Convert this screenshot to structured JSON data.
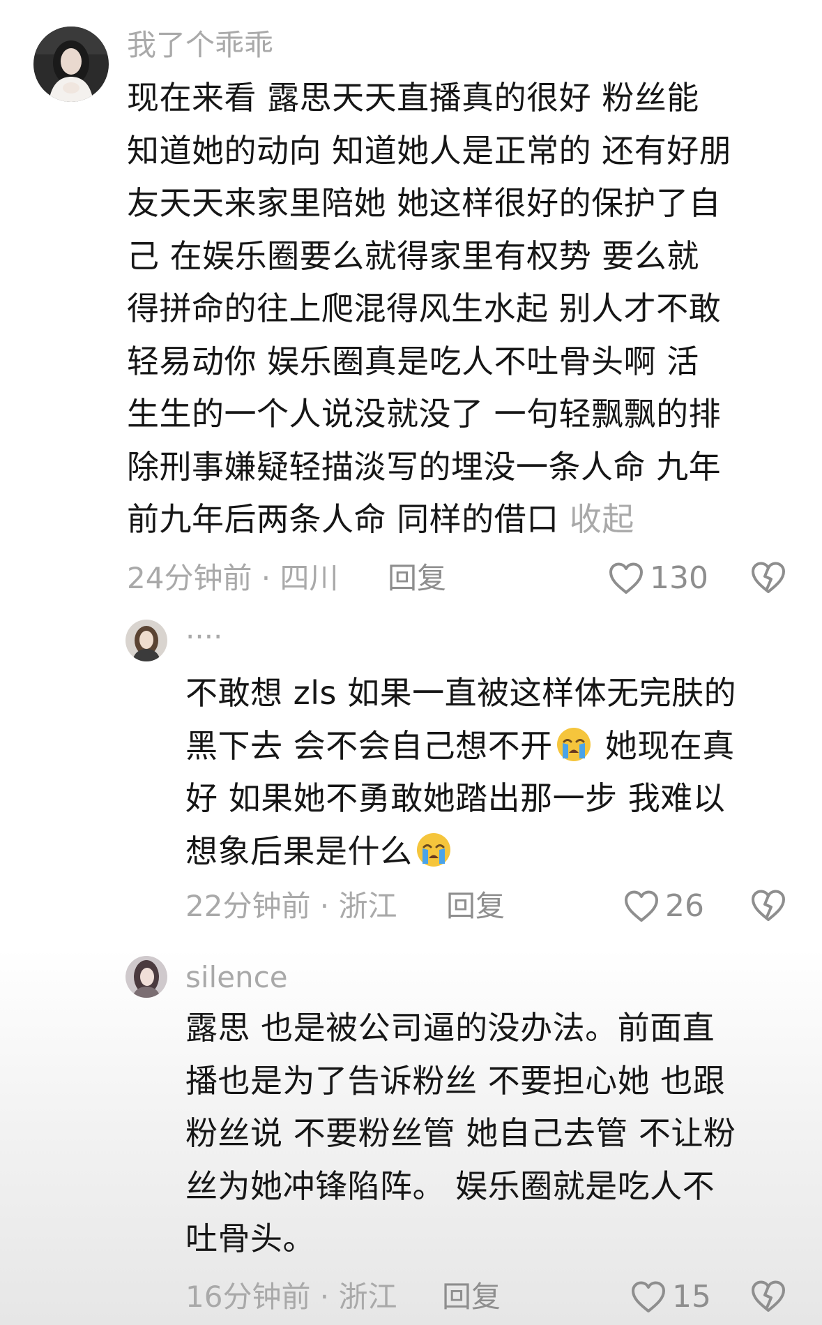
{
  "comments": [
    {
      "username": "我了个乖乖",
      "lines": [
        "现在来看  露思天天直播真的很好 粉丝能",
        "知道她的动向 知道她人是正常的 还有好朋",
        "友天天来家里陪她  她这样很好的保护了自",
        "己  在娱乐圈要么就得家里有权势  要么就",
        "得拼命的往上爬混得风生水起 别人才不敢",
        "轻易动你   娱乐圈真是吃人不吐骨头啊  活",
        "生生的一个人说没就没了  一句轻飘飘的排",
        "除刑事嫌疑轻描淡写的埋没一条人命  九年",
        "前九年后两条人命 同样的借口 "
      ],
      "collapse_label": "收起",
      "time": "24分钟前 · 四川",
      "reply_label": "回复",
      "likes": "130",
      "avatar_icon": "user-avatar",
      "like_icon": "heart-outline-icon",
      "dislike_icon": "broken-heart-icon"
    },
    {
      "username": "....",
      "line1": "不敢想 zls 如果一直被这样体无完肤的",
      "line2a": "黑下去 会不会自己想不开",
      "line2b": " 她现在真",
      "line3": "好 如果她不勇敢她踏出那一步 我难以",
      "line4a": "想象后果是什么",
      "emoji_icon": "loudly-crying-face-emoji",
      "time": "22分钟前 · 浙江",
      "reply_label": "回复",
      "likes": "26"
    },
    {
      "username": "silence",
      "lines": [
        "露思 也是被公司逼的没办法。前面直",
        "播也是为了告诉粉丝 不要担心她 也跟",
        "粉丝说 不要粉丝管 她自己去管 不让粉",
        "丝为她冲锋陷阵。 娱乐圈就是吃人不",
        "吐骨头。"
      ],
      "time": "16分钟前 · 浙江",
      "reply_label": "回复",
      "likes": "15"
    }
  ],
  "colors": {
    "text": "#161616",
    "secondary": "#a9a9a9",
    "action": "#8e8e8e",
    "emoji_face": "#f5c53c",
    "emoji_tears": "#4aa3e8"
  }
}
